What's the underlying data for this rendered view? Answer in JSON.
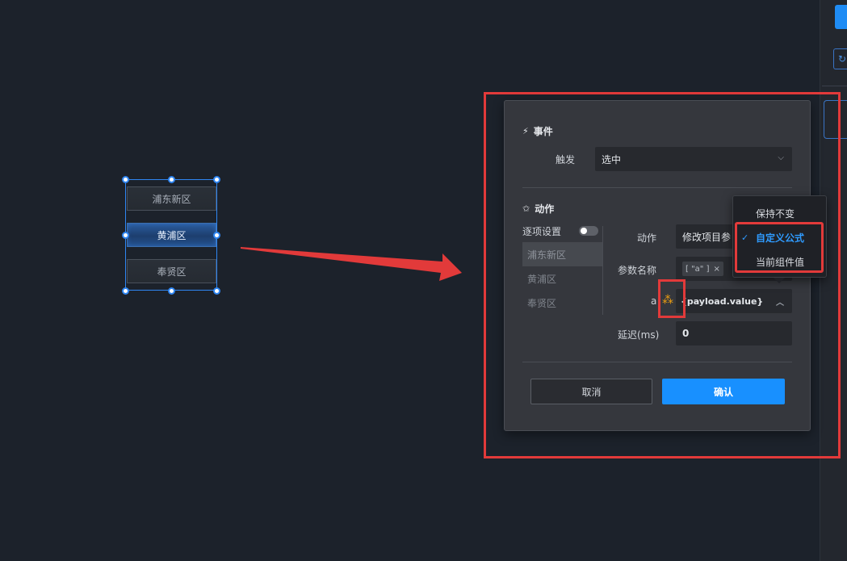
{
  "canvas": {
    "items": [
      {
        "label": "浦东新区",
        "active": false
      },
      {
        "label": "黄浦区",
        "active": true
      },
      {
        "label": "奉贤区",
        "active": false
      }
    ]
  },
  "dialog": {
    "event_section": {
      "icon": "lightning-icon",
      "title": "事件"
    },
    "trigger": {
      "label": "触发",
      "value": "选中"
    },
    "action_section": {
      "icon": "star-icon",
      "title": "动作"
    },
    "per_item": {
      "label": "逐项设置"
    },
    "left_list": [
      {
        "label": "浦东新区",
        "active": true
      },
      {
        "label": "黄浦区",
        "active": false
      },
      {
        "label": "奉贤区",
        "active": false
      }
    ],
    "action": {
      "label": "动作",
      "value": "修改项目参"
    },
    "param_name": {
      "label": "参数名称",
      "tag": "[ \"a\" ]",
      "tag_close": "×"
    },
    "param_a": {
      "label": "a",
      "value": "{payload.value}"
    },
    "delay": {
      "label": "延迟(ms)",
      "value": "0"
    },
    "cancel_label": "取消",
    "confirm_label": "确认"
  },
  "dropdown": {
    "items": [
      {
        "label": "保持不变",
        "selected": false
      },
      {
        "label": "自定义公式",
        "selected": true
      },
      {
        "label": "当前组件值",
        "selected": false
      }
    ]
  },
  "colors": {
    "accent": "#1890ff",
    "highlight_red": "#e23a3a",
    "background": "#1c222b",
    "dialog_bg": "#35373d"
  }
}
